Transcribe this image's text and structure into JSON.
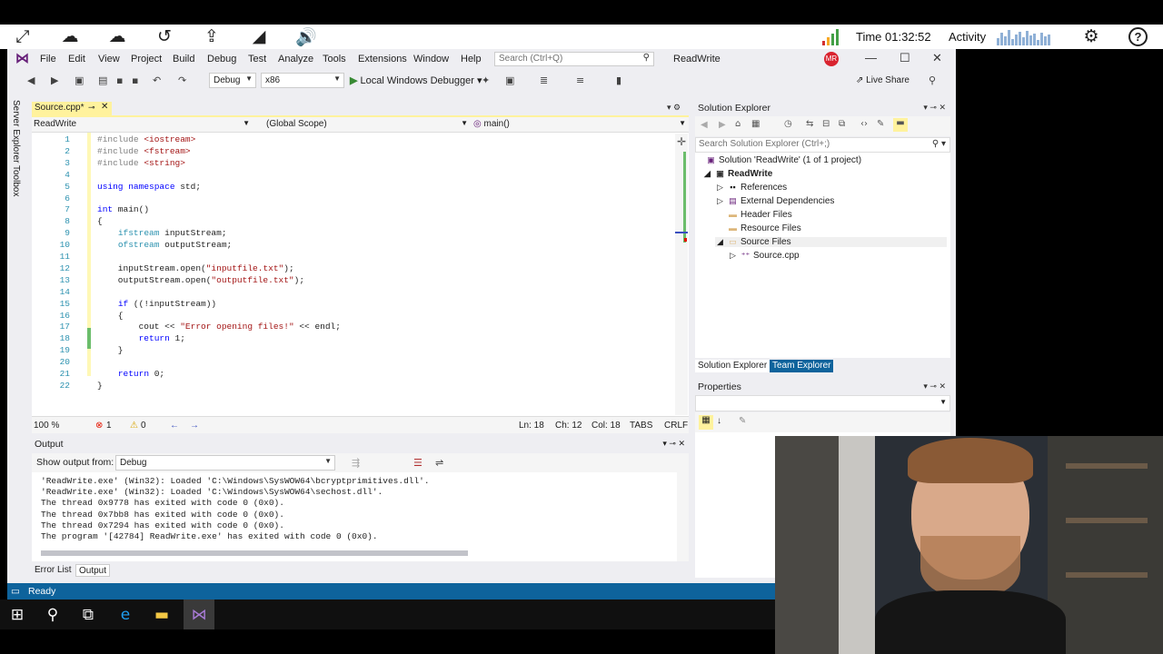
{
  "topbar": {
    "time_label": "Time 01:32:52",
    "activity_label": "Activity",
    "icons": [
      "fullscreen-icon",
      "cloud-upload-icon",
      "cloud-download-icon",
      "history-icon",
      "share-icon",
      "signal-icon",
      "volume-icon"
    ],
    "status_colors": {
      "signal_red": "#d32f2f",
      "signal_yellow": "#f9a825",
      "signal_green": "#43a047"
    }
  },
  "vs": {
    "menu": [
      "File",
      "Edit",
      "View",
      "Project",
      "Build",
      "Debug",
      "Test",
      "Analyze",
      "Tools",
      "Extensions",
      "Window",
      "Help"
    ],
    "search_placeholder": "Search (Ctrl+Q)",
    "solution_name": "ReadWrite",
    "avatar_initials": "MR",
    "toolbar": {
      "config": "Debug",
      "platform": "x86",
      "run_label": "Local Windows Debugger",
      "live_share": "Live Share"
    },
    "left_rail": [
      "Server Explorer",
      "Toolbox"
    ],
    "doc_tab": "Source.cpp*",
    "nav": {
      "project": "ReadWrite",
      "scope": "(Global Scope)",
      "member": "main()"
    },
    "code_lines": [
      {
        "n": "1",
        "text": "#include <iostream>",
        "kind": "pp"
      },
      {
        "n": "2",
        "text": "#include <fstream>",
        "kind": "pp"
      },
      {
        "n": "3",
        "text": "#include <string>",
        "kind": "pp"
      },
      {
        "n": "4",
        "text": "",
        "kind": "plain"
      },
      {
        "n": "5",
        "text": "using namespace std;",
        "kind": "plain"
      },
      {
        "n": "6",
        "text": "",
        "kind": "plain"
      },
      {
        "n": "7",
        "text": "int main()",
        "kind": "plain"
      },
      {
        "n": "8",
        "text": "{",
        "kind": "plain"
      },
      {
        "n": "9",
        "text": "    ifstream inputStream;",
        "kind": "plain"
      },
      {
        "n": "10",
        "text": "    ofstream outputStream;",
        "kind": "plain"
      },
      {
        "n": "11",
        "text": "",
        "kind": "plain"
      },
      {
        "n": "12",
        "text": "    inputStream.open(\"inputfile.txt\");",
        "kind": "plain"
      },
      {
        "n": "13",
        "text": "    outputStream.open(\"outputfile.txt\");",
        "kind": "plain"
      },
      {
        "n": "14",
        "text": "",
        "kind": "plain"
      },
      {
        "n": "15",
        "text": "    if ((!inputStream))",
        "kind": "plain"
      },
      {
        "n": "16",
        "text": "    {",
        "kind": "plain"
      },
      {
        "n": "17",
        "text": "        cout << \"Error opening files!\" << endl;",
        "kind": "plain"
      },
      {
        "n": "18",
        "text": "        return 1;",
        "kind": "plain"
      },
      {
        "n": "19",
        "text": "    }",
        "kind": "plain"
      },
      {
        "n": "20",
        "text": "",
        "kind": "plain"
      },
      {
        "n": "21",
        "text": "    return 0;",
        "kind": "plain"
      },
      {
        "n": "22",
        "text": "}",
        "kind": "plain"
      }
    ],
    "editor_status": {
      "zoom": "100 %",
      "errors": "1",
      "warnings": "0",
      "ln": "Ln: 18",
      "ch": "Ch: 12",
      "col": "Col: 18",
      "tabs": "TABS",
      "eol": "CRLF"
    },
    "output": {
      "title": "Output",
      "show_from_label": "Show output from:",
      "source": "Debug",
      "lines": [
        "'ReadWrite.exe' (Win32): Loaded 'C:\\Windows\\SysWOW64\\bcryptprimitives.dll'.",
        "'ReadWrite.exe' (Win32): Loaded 'C:\\Windows\\SysWOW64\\sechost.dll'.",
        "The thread 0x9778 has exited with code 0 (0x0).",
        "The thread 0x7bb8 has exited with code 0 (0x0).",
        "The thread 0x7294 has exited with code 0 (0x0).",
        "The program '[42784] ReadWrite.exe' has exited with code 0 (0x0)."
      ],
      "tabs": [
        "Error List",
        "Output"
      ]
    },
    "status": "Ready",
    "solution_explorer": {
      "title": "Solution Explorer",
      "search_placeholder": "Search Solution Explorer (Ctrl+;)",
      "items": [
        {
          "label": "Solution 'ReadWrite' (1 of 1 project)",
          "icon": "solution-icon"
        },
        {
          "label": "ReadWrite",
          "icon": "project-icon"
        },
        {
          "label": "References",
          "icon": "references-icon"
        },
        {
          "label": "External Dependencies",
          "icon": "dependencies-icon"
        },
        {
          "label": "Header Files",
          "icon": "folder-icon"
        },
        {
          "label": "Resource Files",
          "icon": "folder-icon"
        },
        {
          "label": "Source Files",
          "icon": "folder-icon"
        },
        {
          "label": "Source.cpp",
          "icon": "cpp-file-icon"
        }
      ],
      "tabs": [
        "Solution Explorer",
        "Team Explorer"
      ]
    },
    "properties_title": "Properties"
  }
}
